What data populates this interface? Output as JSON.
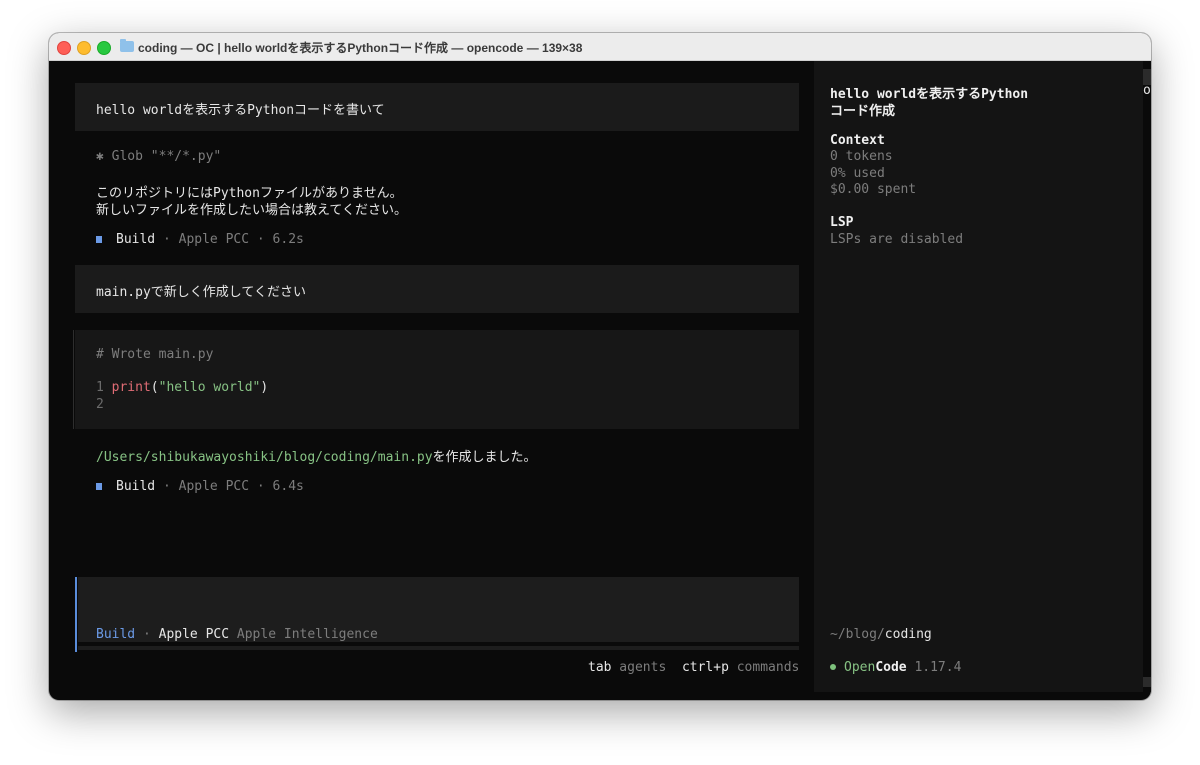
{
  "window": {
    "title": "coding — OC | hello worldを表示するPythonコード作成 — opencode — 139×38"
  },
  "conversation": {
    "user_msg_1": "hello worldを表示するPythonコードを書いて",
    "tool_glob": "✱ Glob \"**/*.py\"",
    "assistant_1_line1": "このリポジトリにはPythonファイルがありません。",
    "assistant_1_line2": "新しいファイルを作成したい場合は教えてください。",
    "build_1": {
      "agent": "Build",
      "sep": " · ",
      "model": "Apple PCC",
      "time": " · 6.2s"
    },
    "user_msg_2": "main.pyで新しく作成してください",
    "tool_write_title": "# Wrote main.py",
    "code_lines": [
      {
        "num": "1",
        "fn": "print",
        "open": "(",
        "str": "\"hello world\"",
        "close": ")"
      },
      {
        "num": "2"
      }
    ],
    "result_path": "/Users/shibukawayoshiki/blog/coding/main.py",
    "result_suffix": "を作成しました。",
    "build_2": {
      "agent": "Build",
      "sep": " · ",
      "model": "Apple PCC",
      "time": " · 6.4s"
    }
  },
  "input": {
    "agent": "Build",
    "sep": " · ",
    "model": "Apple PCC",
    "provider": " Apple Intelligence"
  },
  "hints": {
    "tab_key": "tab",
    "tab_label": " agents",
    "cmd_key": "ctrl+p",
    "cmd_label": " commands"
  },
  "sidebar": {
    "session_title_1": "hello worldを表示するPython",
    "session_title_2": "コード作成",
    "context_heading": "Context",
    "tokens": "0 tokens",
    "used": "0% used",
    "spent": "$0.00 spent",
    "lsp_heading": "LSP",
    "lsp_status": "LSPs are disabled",
    "cwd_prefix": "~/blog/",
    "cwd_dir": "coding",
    "app_name_a": "Open",
    "app_name_b": "Code",
    "version": " 1.17.4"
  },
  "overflow_char": "o"
}
